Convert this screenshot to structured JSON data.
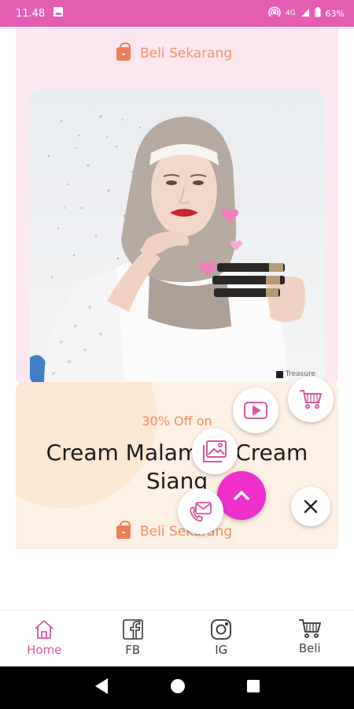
{
  "status_bar": {
    "time": "11.48",
    "network": "4G",
    "battery": "63%"
  },
  "card1": {
    "cta_label": "Beli Sekarang",
    "watermark": "Treasure"
  },
  "card2": {
    "discount": "30% Off on",
    "title_line1": "Cream Malam",
    "title_line2": "Cream",
    "title_line3": "Siang",
    "cta_label": "Beli Sekarang"
  },
  "bottom_nav": {
    "items": [
      {
        "label": "Home",
        "icon": "home-icon",
        "active": true
      },
      {
        "label": "FB",
        "icon": "facebook-icon",
        "active": false
      },
      {
        "label": "IG",
        "icon": "instagram-icon",
        "active": false
      },
      {
        "label": "Beli",
        "icon": "cart-icon",
        "active": false
      }
    ]
  },
  "colors": {
    "accent": "#ee2fcb",
    "status_bar": "#e55eb3",
    "cta": "#f08f66",
    "nav_active": "#d9569f",
    "card1_bg": "#fce6ef",
    "card2_bg": "#fdf0e4"
  }
}
